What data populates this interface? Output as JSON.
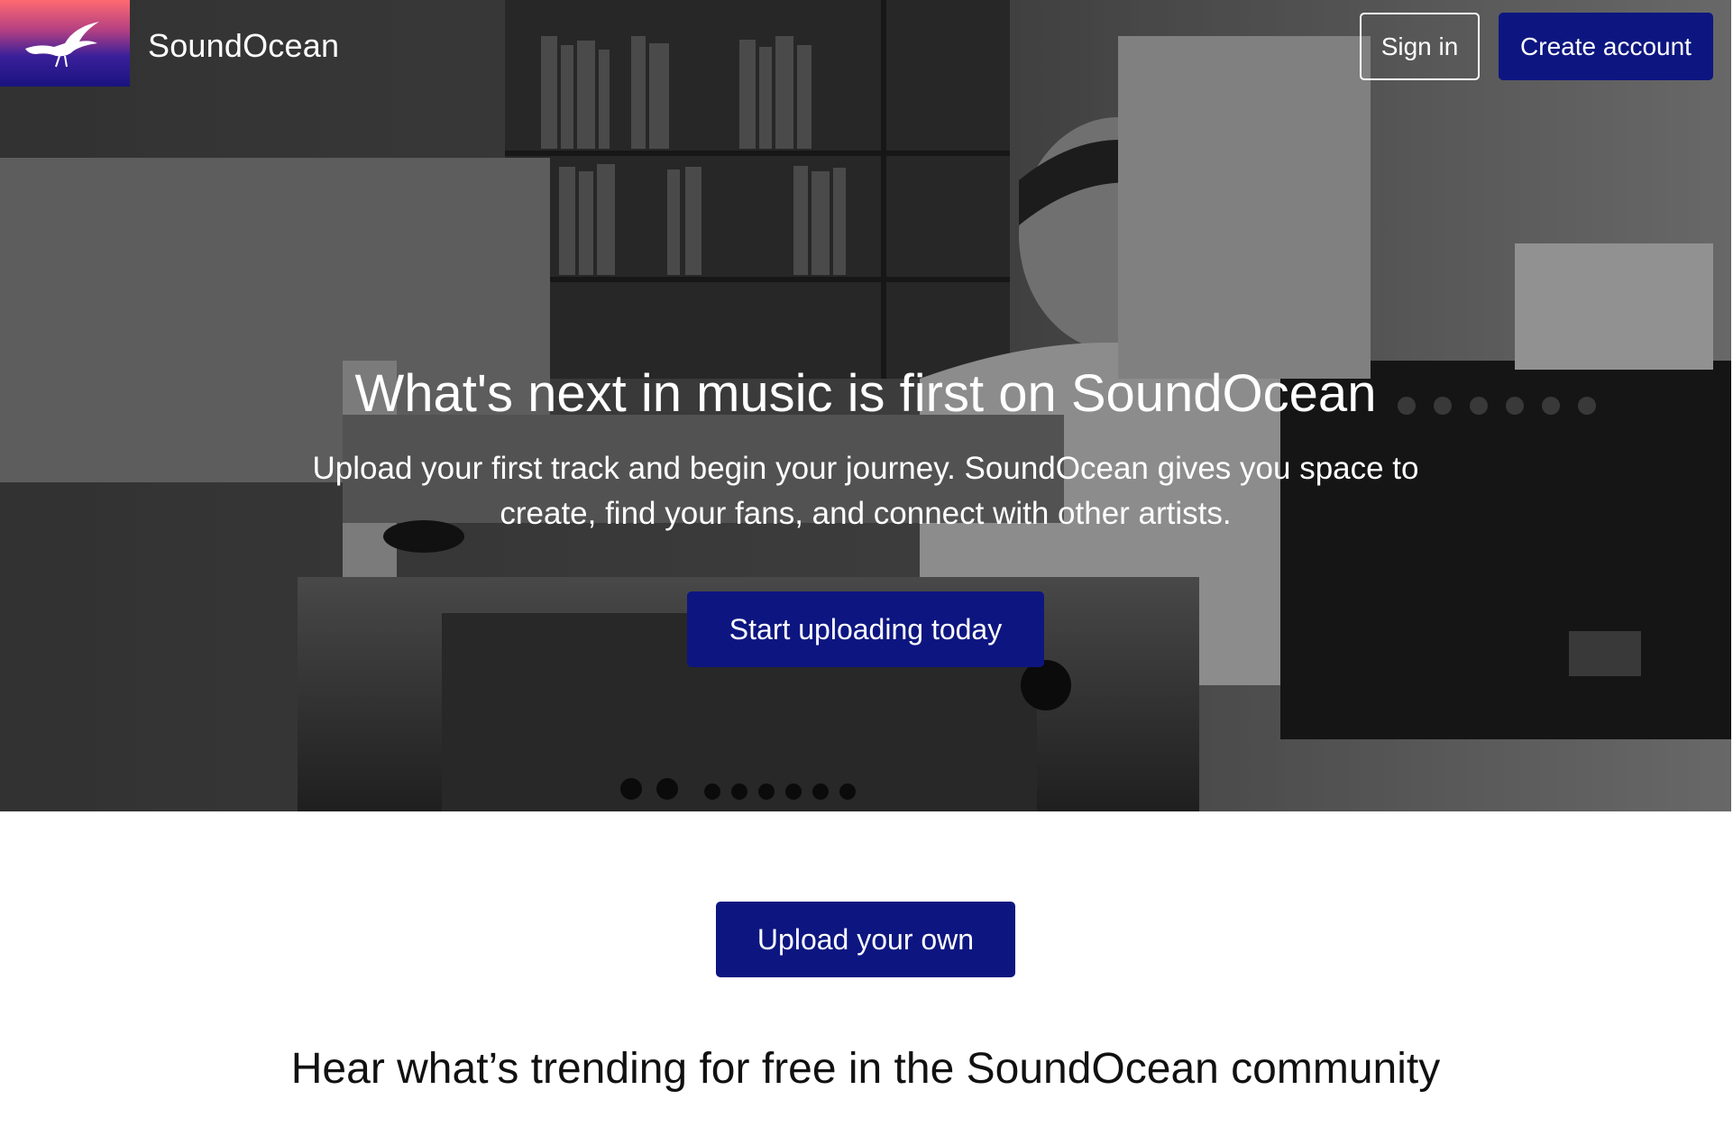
{
  "brand": {
    "name": "SoundOcean",
    "logo_icon": "seagull-icon",
    "logo_gradient": [
      "#ff6a70",
      "#1a1380"
    ]
  },
  "header": {
    "signin_label": "Sign in",
    "create_account_label": "Create account"
  },
  "hero": {
    "title": "What's next in music is first on SoundOcean",
    "subtitle": "Upload your first track and begin your journey. SoundOcean gives you space to create, find your fans, and connect with other artists.",
    "cta_label": "Start uploading today"
  },
  "main": {
    "upload_label": "Upload your own",
    "trending_heading": "Hear what’s trending for free in the SoundOcean community"
  },
  "colors": {
    "primary_button": "#0d1680",
    "hero_overlay": "#000000",
    "text_light": "#ffffff",
    "text_dark": "#111111"
  }
}
